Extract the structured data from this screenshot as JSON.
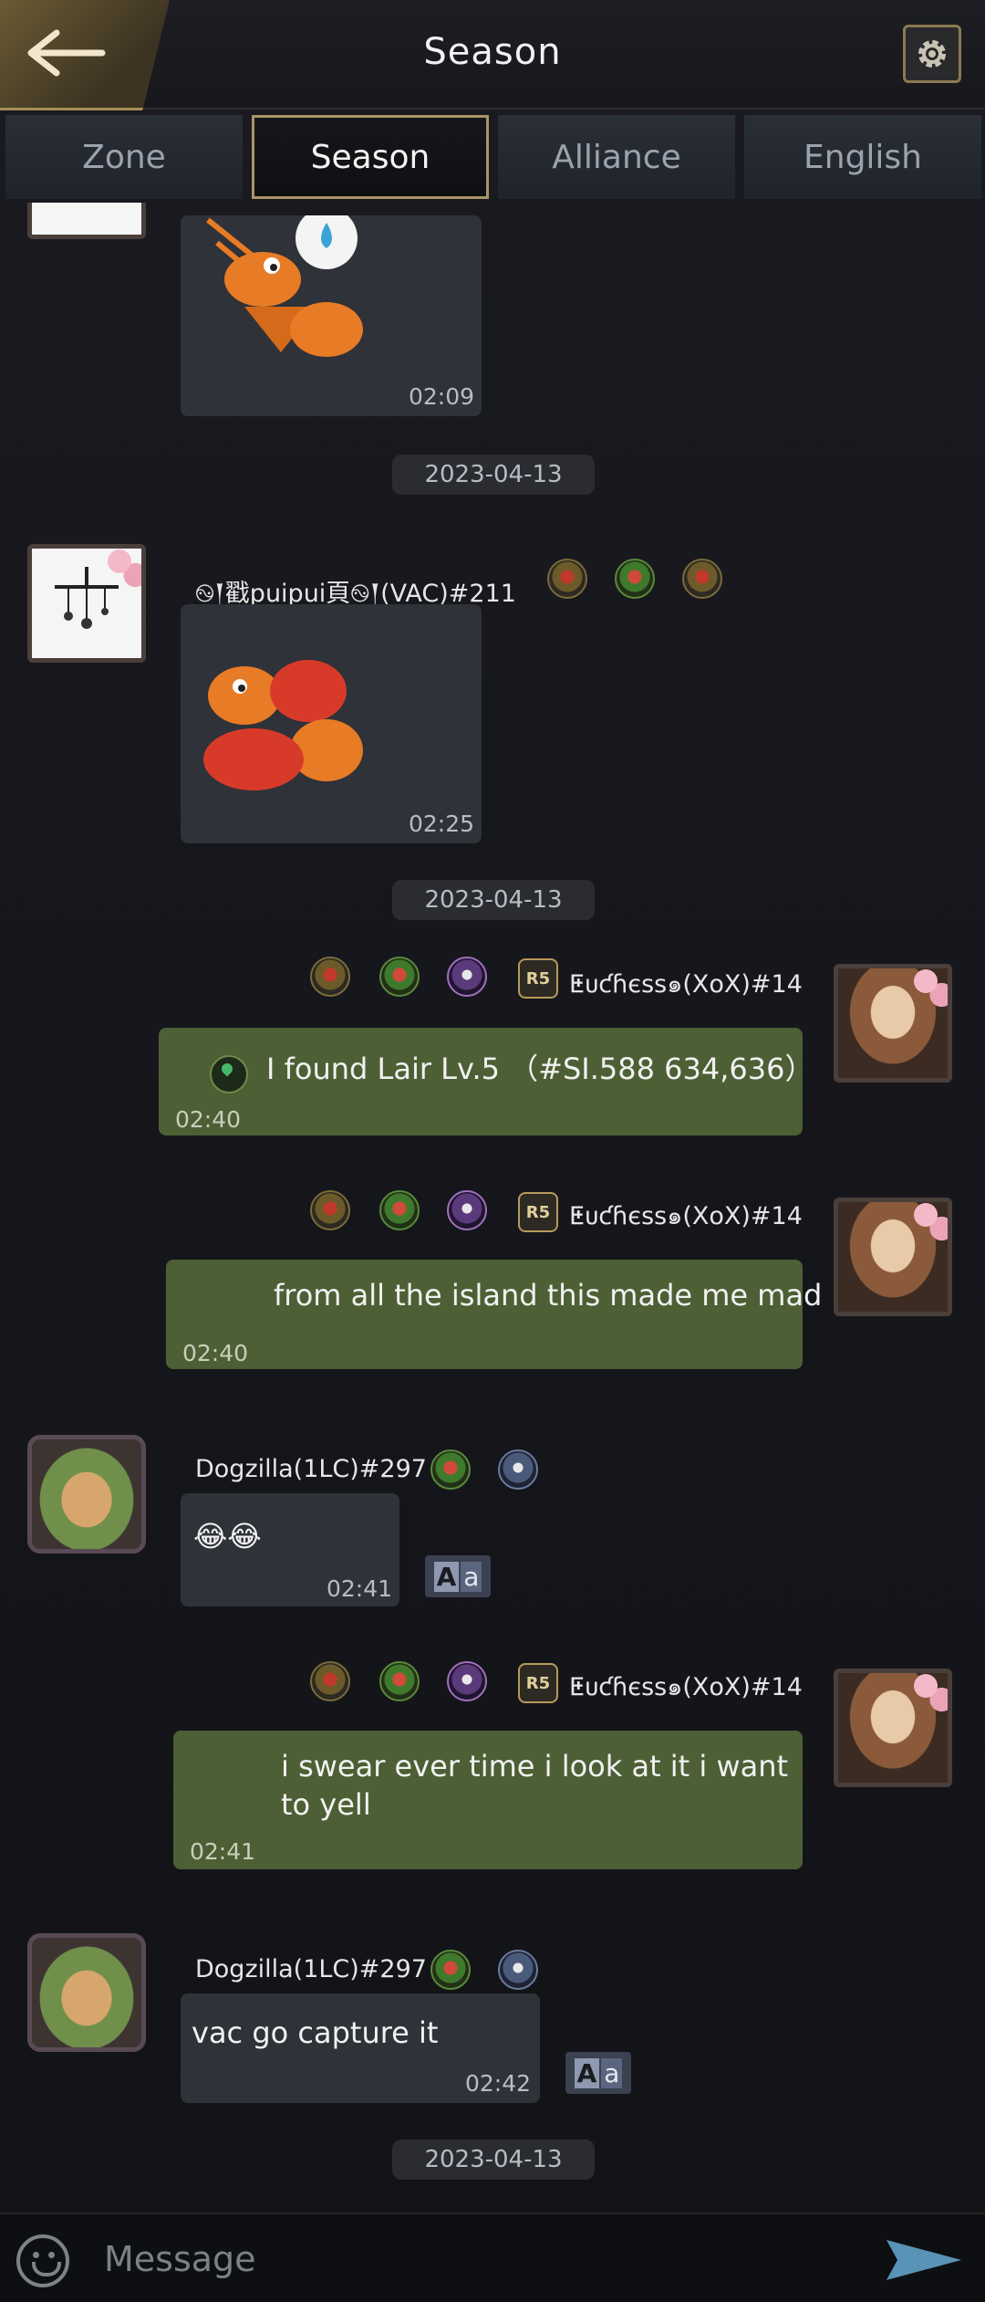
{
  "header": {
    "title": "Season"
  },
  "tabs": [
    {
      "label": "Zone"
    },
    {
      "label": "Season"
    },
    {
      "label": "Alliance"
    },
    {
      "label": "English"
    }
  ],
  "messages": [
    {
      "time": "02:09"
    },
    {
      "date": "2023-04-13"
    },
    {
      "name": "࿊𒑰戳puipui頁࿊𒑰(VAC)#211",
      "time": "02:25"
    },
    {
      "date": "2023-04-13"
    },
    {
      "name": "ⵟᴜƈɦєѕѕ๑(XoX)#14",
      "text": "I found Lair Lv.5  （#SI.588 634,636）",
      "time": "02:40"
    },
    {
      "name": "ⵟᴜƈɦєѕѕ๑(XoX)#14",
      "text": "from all the island this made me mad",
      "time": "02:40"
    },
    {
      "name": "Dogzilla(1LC)#297",
      "text": "😂😂",
      "time": "02:41"
    },
    {
      "name": "ⵟᴜƈɦєѕѕ๑(XoX)#14",
      "text": "i swear ever time i look at it i want to yell",
      "time": "02:41"
    },
    {
      "name": "Dogzilla(1LC)#297",
      "text": "vac go capture it",
      "time": "02:42"
    },
    {
      "date": "2023-04-13"
    }
  ],
  "rank_badge": "R5",
  "translate_labels": [
    "A",
    "a"
  ],
  "input": {
    "placeholder": "Message"
  },
  "colors": {
    "own_bubble": "#4d5f34",
    "other_bubble": "#2f3238",
    "accent_gold": "#a89566"
  }
}
